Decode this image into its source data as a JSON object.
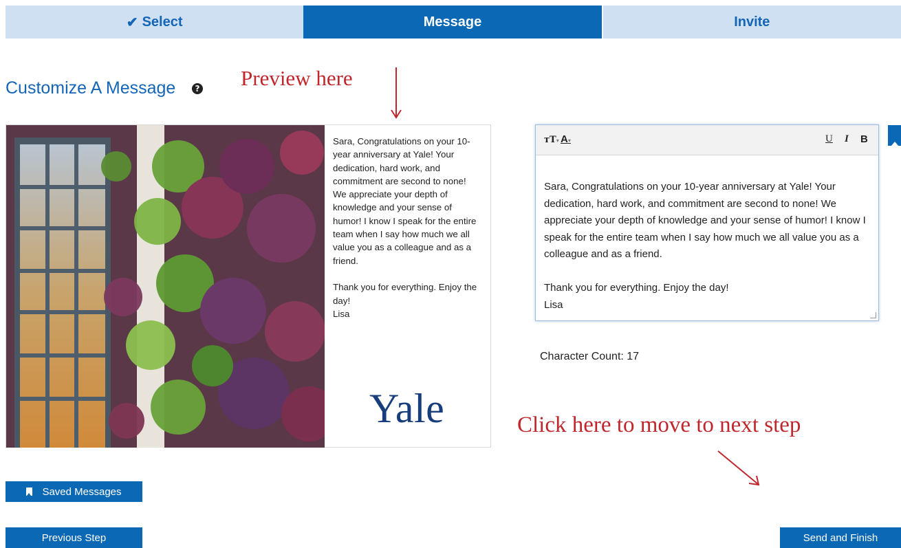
{
  "steps": [
    {
      "label": "Select",
      "state": "done",
      "icon": "check-icon"
    },
    {
      "label": "Message",
      "state": "active"
    },
    {
      "label": "Invite",
      "state": "todo"
    }
  ],
  "heading": {
    "title": "Customize A Message",
    "help_icon": "question-circle-icon"
  },
  "annotations": {
    "preview": "Preview here",
    "next_step": "Click here to move to next step"
  },
  "card": {
    "message": "Sara, Congratulations on your 10-year anniversary at Yale! Your dedication, hard work, and commitment are second to none! We appreciate your depth of knowledge and your sense of humor! I know I speak for the entire team when I say how much we all value you as a colleague and as a friend.\n\nThank you for everything. Enjoy the day!\nLisa",
    "logo_text": "Yale"
  },
  "editor": {
    "toolbar": {
      "font_size": "тT",
      "font_color": "A",
      "underline": "U",
      "italic": "I",
      "bold": "B"
    },
    "text": "Sara, Congratulations on your 10-year anniversary at Yale! Your dedication, hard work, and commitment are second to none! We appreciate your depth of knowledge and your sense of humor! I know I speak for the entire team when I say how much we all value you as a colleague and as a friend.\n\nThank you for everything. Enjoy the day!\nLisa"
  },
  "character_count": {
    "label": "Character Count: 17"
  },
  "buttons": {
    "saved_messages": "Saved Messages",
    "previous_step": "Previous Step",
    "send_and_finish": "Send and Finish"
  },
  "colors": {
    "primary": "#0a68b4",
    "tab_inactive": "#cfe0f3",
    "annotation": "#c0272d",
    "yale_blue": "#183d7c"
  }
}
